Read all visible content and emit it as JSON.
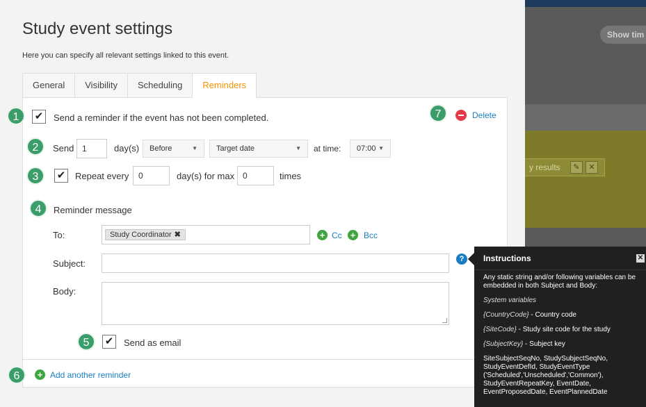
{
  "background": {
    "show_button": "Show tim",
    "results_label": "y results"
  },
  "modal": {
    "title": "Study event settings",
    "subtitle": "Here you can specify all relevant settings linked to this event.",
    "tabs": [
      {
        "label": "General"
      },
      {
        "label": "Visibility"
      },
      {
        "label": "Scheduling"
      },
      {
        "label": "Reminders"
      }
    ],
    "active_tab": "Reminders"
  },
  "reminder": {
    "enabled_label": "Send a reminder if the event has not been completed.",
    "delete_label": "Delete",
    "send_label": "Send",
    "days_value": "1",
    "days_unit": "day(s)",
    "relation": "Before",
    "target": "Target date",
    "at_time_label": "at time:",
    "time": "07:00",
    "repeat_label": "Repeat every",
    "repeat_value": "0",
    "repeat_unit": "day(s) for max",
    "max_value": "0",
    "times_label": "times",
    "message_heading": "Reminder message",
    "to_label": "To:",
    "recipient": "Study Coordinator",
    "cc_label": "Cc",
    "bcc_label": "Bcc",
    "subject_label": "Subject:",
    "subject_value": "",
    "body_label": "Body:",
    "body_value": "",
    "send_email_label": "Send as email",
    "add_another_label": "Add another reminder"
  },
  "markers": [
    "1",
    "2",
    "3",
    "4",
    "5",
    "6",
    "7"
  ],
  "instructions": {
    "title": "Instructions",
    "close": "✕",
    "intro": "Any static string and/or following variables can be embedded in both Subject and Body:",
    "system_heading": "System variables",
    "variables": [
      {
        "code": "{CountryCode}",
        "desc": " - Country code"
      },
      {
        "code": "{SiteCode}",
        "desc": " - Study site code for the study"
      },
      {
        "code": "{SubjectKey}",
        "desc": " - Subject key"
      }
    ],
    "more": "SiteSubjectSeqNo, StudySubjectSeqNo, StudyEventDefId, StudyEventType ('Scheduled','Unscheduled','Common'), StudyEventRepeatKey, EventDate, EventProposedDate, EventPlannedDate"
  },
  "colors": {
    "accent_orange": "#f39200",
    "link_blue": "#1a7ec2",
    "marker_green": "#3b9e6a",
    "delete_red": "#e63946"
  }
}
